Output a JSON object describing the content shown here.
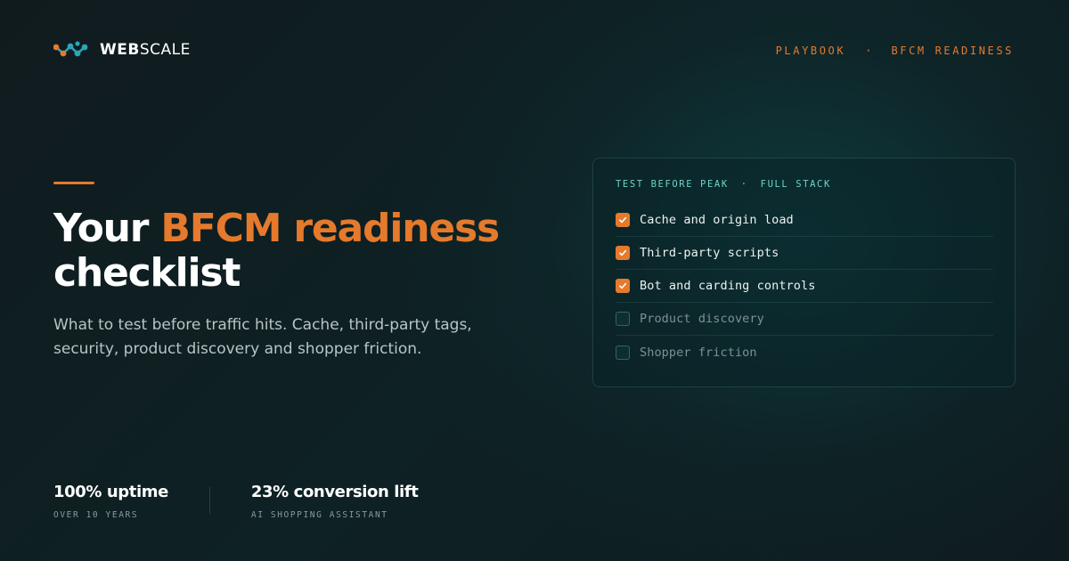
{
  "brand": {
    "logo_icon": "webscale-logo-icon",
    "name_bold": "WEB",
    "name_regular": "SCALE"
  },
  "nav": {
    "items": [
      "PLAYBOOK",
      "BFCM READINESS"
    ],
    "separator": "·"
  },
  "hero": {
    "title_part1": "Your ",
    "title_highlight": "BFCM readiness",
    "title_part2": "checklist",
    "subtitle": "What to test before traffic hits. Cache, third-party tags, security, product discovery and shopper friction."
  },
  "checklist": {
    "eyebrow_left": "TEST BEFORE PEAK",
    "eyebrow_sep": "·",
    "eyebrow_right": "FULL STACK",
    "items": [
      {
        "label": "Cache and origin load",
        "checked": true
      },
      {
        "label": "Third-party scripts",
        "checked": true
      },
      {
        "label": "Bot and carding controls",
        "checked": true
      },
      {
        "label": "Product discovery",
        "checked": false
      },
      {
        "label": "Shopper friction",
        "checked": false
      }
    ]
  },
  "stats": [
    {
      "value": "100% uptime",
      "caption": "OVER 10 YEARS"
    },
    {
      "value": "23% conversion lift",
      "caption": "AI SHOPPING ASSISTANT"
    }
  ],
  "colors": {
    "accent": "#e57a2c",
    "teal": "#6fd3c8",
    "background": "#0f1c1f"
  }
}
